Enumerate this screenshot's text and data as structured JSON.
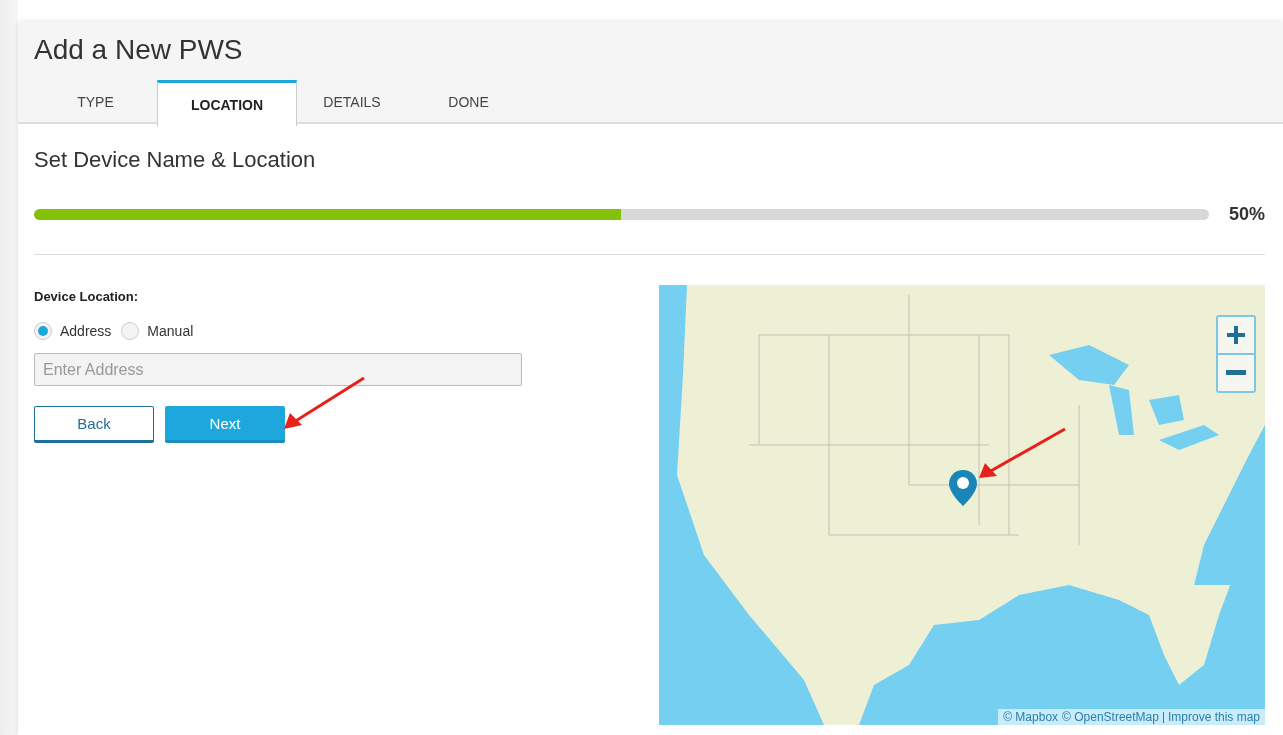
{
  "header": {
    "title": "Add a New PWS"
  },
  "tabs": [
    {
      "label": "TYPE",
      "selected": false
    },
    {
      "label": "LOCATION",
      "selected": true
    },
    {
      "label": "DETAILS",
      "selected": false
    },
    {
      "label": "DONE",
      "selected": false
    }
  ],
  "section_title": "Set Device Name & Location",
  "progress": {
    "level": 0.5,
    "reading": "50%"
  },
  "device_location": {
    "label": "Device Location:",
    "options": [
      {
        "label": "Address",
        "selected": true
      },
      {
        "label": "Manual",
        "selected": false
      }
    ],
    "address_field": {
      "placeholder": "Enter Address"
    }
  },
  "buttons": [
    {
      "label": "Back",
      "kind": "secondary"
    },
    {
      "label": "Next",
      "kind": "primary"
    }
  ],
  "map": {
    "attribution": [
      "© Mapbox",
      "© OpenStreetMap",
      "Improve this map"
    ]
  }
}
